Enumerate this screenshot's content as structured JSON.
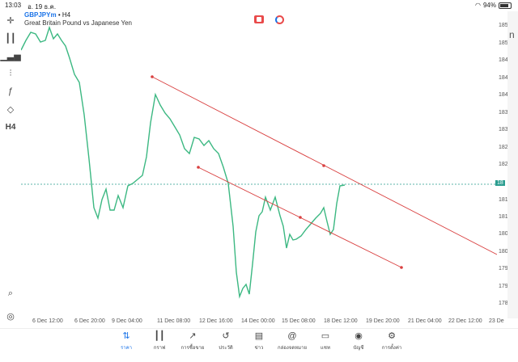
{
  "status": {
    "time": "13:03",
    "date": "อ. 19 ธ.ค.",
    "battery": "94%"
  },
  "symbol": {
    "ticker": "GBPJPYm",
    "timeframe": "• H4",
    "description": "Great Britain Pound vs Japanese Yen"
  },
  "toolbar_icons": [
    "crosshair-icon",
    "candles-icon",
    "bars-icon",
    "indicators-icon",
    "function-icon",
    "shapes-icon",
    "timeframe-h4"
  ],
  "timeframe_label": "H4",
  "price_labels": [
    "185",
    "185",
    "184",
    "184",
    "184",
    "183",
    "183",
    "182",
    "182",
    "181",
    "181",
    "180",
    "180",
    "179",
    "179",
    "178"
  ],
  "current_price_label": "18",
  "time_labels": [
    "6 Dec 12:00",
    "6 Dec 20:00",
    "9 Dec 04:00",
    "11 Dec 08:00",
    "12 Dec 16:00",
    "14 Dec 00:00",
    "15 Dec 08:00",
    "18 Dec 12:00",
    "19 Dec 20:00",
    "21 Dec 04:00",
    "22 Dec 12:00",
    "23 De"
  ],
  "tabs": [
    {
      "label": "ราคา",
      "icon": "quotes-icon",
      "active": true
    },
    {
      "label": "กราฟ",
      "icon": "chart-icon",
      "active": false
    },
    {
      "label": "การซื้อขาย",
      "icon": "trade-icon",
      "active": false
    },
    {
      "label": "ประวัติ",
      "icon": "history-icon",
      "active": false
    },
    {
      "label": "ข่าว",
      "icon": "news-icon",
      "active": false
    },
    {
      "label": "กล่องจดหมาย",
      "icon": "mail-icon",
      "active": false
    },
    {
      "label": "แชท",
      "icon": "chat-icon",
      "active": false
    },
    {
      "label": "บัญชี",
      "icon": "account-icon",
      "active": false
    },
    {
      "label": "การตั้งค่า",
      "icon": "settings-icon",
      "active": false
    }
  ],
  "side_panel_letter": "n",
  "colors": {
    "line": "#3cb882",
    "trend": "#d94040",
    "accent": "#1a73e8",
    "current": "#2a9d8f"
  }
}
